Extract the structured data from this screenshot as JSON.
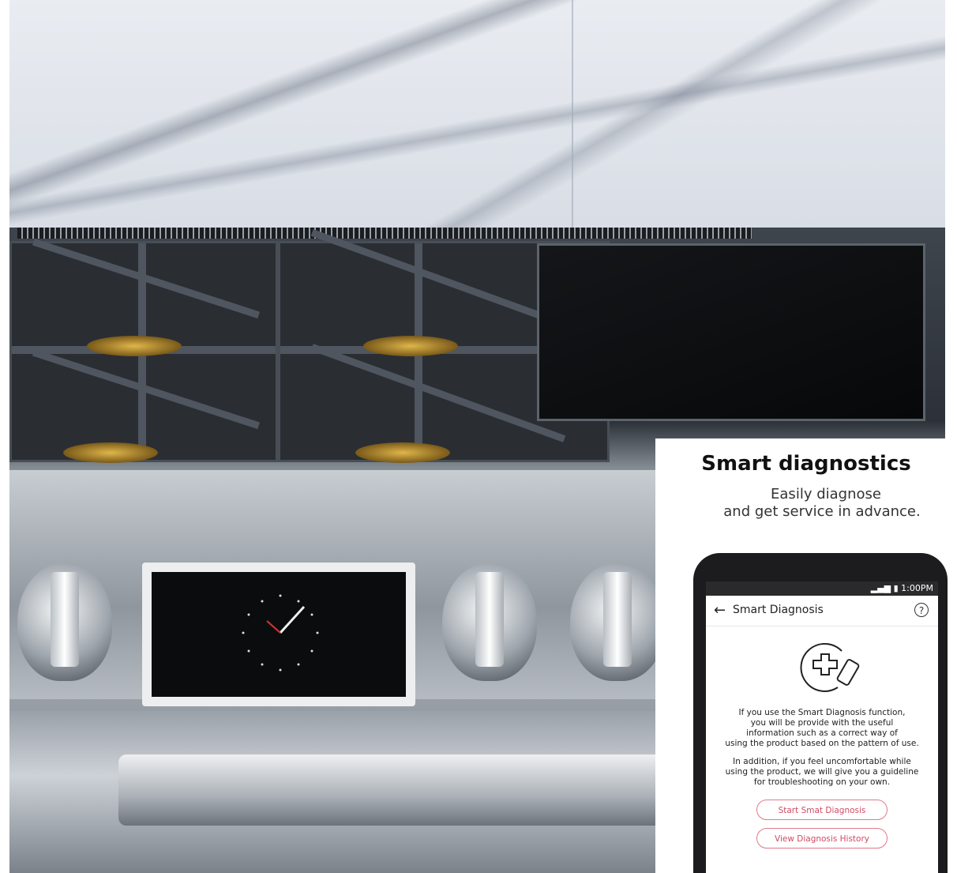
{
  "card": {
    "title": "Smart diagnostics",
    "subtitle_line1": "Easily diagnose",
    "subtitle_line2": "and get service in advance."
  },
  "phone": {
    "status_time": "1:00PM",
    "app_title": "Smart Diagnosis",
    "help_glyph": "?",
    "back_glyph": "←",
    "paragraph1": [
      "If you use the Smart Diagnosis function,",
      "you will be provide with the useful",
      "information such as a correct way of",
      "using the product based on the pattern of use."
    ],
    "paragraph2": [
      "In addition, if you feel uncomfortable while",
      "using the product, we will give you a guideline",
      "for troubleshooting on your own."
    ],
    "start_button": "Start Smat Diagnosis",
    "history_button": "View Diagnosis History",
    "accent": "#d14a63"
  },
  "icons": [
    "back-arrow-icon",
    "help-icon",
    "diagnosis-phone-icon",
    "signal-icon",
    "battery-icon"
  ]
}
